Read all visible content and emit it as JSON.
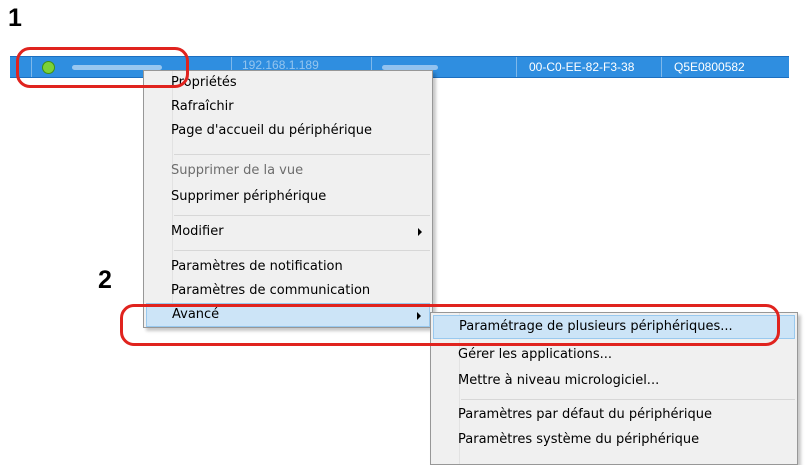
{
  "steps": {
    "step1": "1",
    "step2": "2"
  },
  "device_row": {
    "ip": "192.168.1.189",
    "mac": "00-C0-EE-82-F3-38",
    "serial": "Q5E0800582"
  },
  "context_menu": {
    "items": [
      "Propriétés",
      "Rafraîchir",
      "Page d'accueil du périphérique",
      "Supprimer de la vue",
      "Supprimer périphérique",
      "Modifier",
      "Paramètres de notification",
      "Paramètres de communication",
      "Avancé"
    ]
  },
  "submenu": {
    "items": [
      "Paramétrage de plusieurs périphériques...",
      "Gérer les applications...",
      "Mettre à niveau micrologiciel...",
      "Paramètres par défaut du périphérique",
      "Paramètres système du périphérique"
    ]
  },
  "colors": {
    "row_selected": "#2f8ee0",
    "callout_red": "#e0231e",
    "menu_highlight": "#cce4f7",
    "status_online": "#7cd238"
  }
}
